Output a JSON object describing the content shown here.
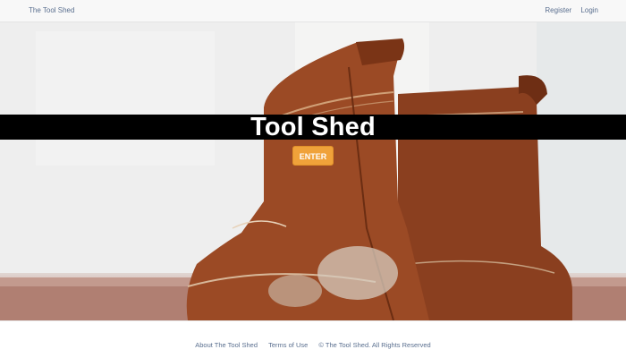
{
  "nav": {
    "brand": "The Tool Shed",
    "register": "Register",
    "login": "Login"
  },
  "hero": {
    "title": "Tool Shed",
    "enter": "ENTER"
  },
  "footer": {
    "about": "About The Tool Shed",
    "terms": "Terms of Use",
    "copyright": "© The Tool Shed. All Rights Reserved"
  },
  "colors": {
    "accent": "#f0a23a",
    "link": "#5a6f8f",
    "band": "#000000"
  }
}
